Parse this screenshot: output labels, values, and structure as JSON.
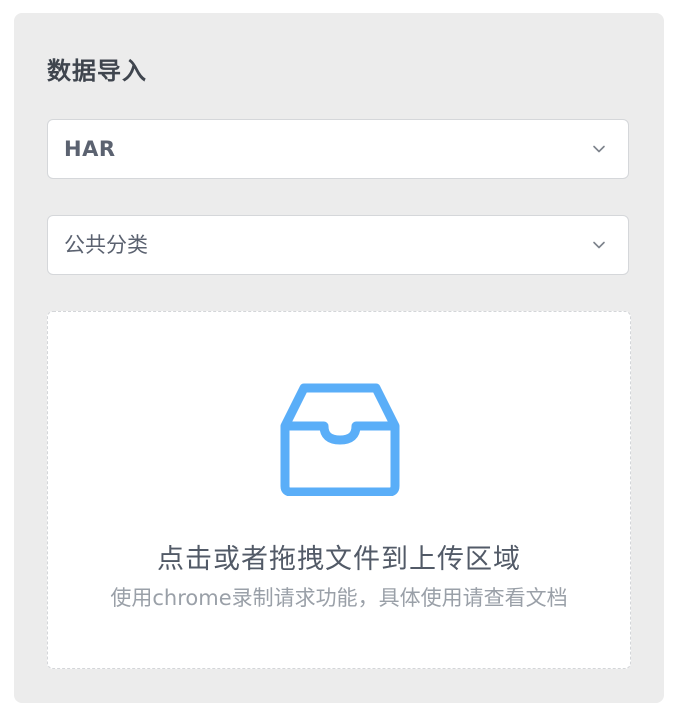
{
  "panel": {
    "title": "数据导入"
  },
  "import_type_select": {
    "value": "HAR",
    "icon": "chevron-down-icon"
  },
  "category_select": {
    "value": "公共分类",
    "icon": "chevron-down-icon"
  },
  "upload": {
    "icon": "inbox-icon",
    "main_text": "点击或者拖拽文件到上传区域",
    "hint_text": "使用chrome录制请求功能，具体使用请查看文档"
  },
  "colors": {
    "panel_background": "#ececec",
    "accent": "#5aaef8",
    "title_text": "#3f454e",
    "hint_text": "#9aa0a8"
  }
}
